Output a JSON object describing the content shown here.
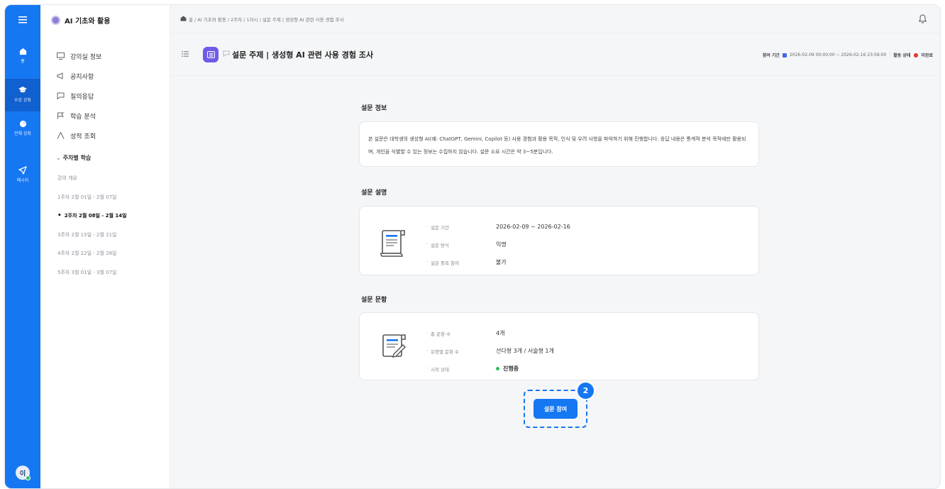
{
  "rail": {
    "items": [
      {
        "label": "홈",
        "icon": "home-icon"
      },
      {
        "label": "수강 강좌",
        "icon": "graduation-cap-icon"
      },
      {
        "label": "전체 강좌",
        "icon": "pie-chart-icon"
      },
      {
        "label": "메시지",
        "icon": "send-icon"
      }
    ],
    "avatar": "이"
  },
  "sidebar": {
    "course_title": "AI 기초와 활용",
    "menu": [
      {
        "label": "강의실 정보",
        "icon": "classroom-icon"
      },
      {
        "label": "공지사항",
        "icon": "megaphone-icon"
      },
      {
        "label": "질의응답",
        "icon": "chat-icon"
      },
      {
        "label": "학습 분석",
        "icon": "flag-icon"
      },
      {
        "label": "성적 조회",
        "icon": "grade-icon"
      }
    ],
    "weekly_heading": "주차별 학습",
    "weeks": [
      {
        "label": "강의 개요",
        "current": false
      },
      {
        "label": "1주차 2월 01일 - 2월 07일",
        "current": false
      },
      {
        "label": "2주차 2월 08일 - 2월 14일",
        "current": true
      },
      {
        "label": "3주차 2월 15일 - 2월 21일",
        "current": false
      },
      {
        "label": "4주차 2월 22일 - 2월 28일",
        "current": false
      },
      {
        "label": "5주차 3월 01일 - 3월 07일",
        "current": false
      }
    ]
  },
  "breadcrumb": "홈 / AI 기초와 활용 / 2주차 / 1차시 / 설문 주제 | 생성형 AI 관련 사용 경험 조사",
  "header": {
    "title": "설문 주제 | 생성형 AI 관련 사용 경험 조사",
    "period_label": "참여 기간",
    "period_value": "2026-02-09 00:00:00 ~ 2026-02-16 23:59:00",
    "status_label": "활동 상태",
    "status_value": "미완료"
  },
  "survey_info": {
    "heading": "설문 정보",
    "text": "본 설문은 대학생의 생성형 AI(예: ChatGPT, Gemini, Copilot 등) 사용 경험과 활용 목적, 인식 및 우려 사항을 파악하기 위해 진행합니다. 응답 내용은 통계적 분석 목적에만 활용되며, 개인을 식별할 수 있는 정보는 수집하지 않습니다. 설문 소요 시간은 약 3~5분입니다."
  },
  "survey_desc": {
    "heading": "설문 설명",
    "rows": [
      {
        "key": "설문 기간",
        "value": "2026-02-09 ~ 2026-02-16"
      },
      {
        "key": "설문 방식",
        "value": "익명"
      },
      {
        "key": "설문 중복 참여",
        "value": "불가"
      }
    ]
  },
  "survey_items": {
    "heading": "설문 문항",
    "rows": [
      {
        "key": "총 문항 수",
        "value": "4개"
      },
      {
        "key": "유형별 문항 수",
        "value": "선다형 3개 / 서술형 1개"
      },
      {
        "key": "시작 상태",
        "value": "진행중"
      }
    ]
  },
  "join_button": "설문 참여",
  "step_badge": "2"
}
